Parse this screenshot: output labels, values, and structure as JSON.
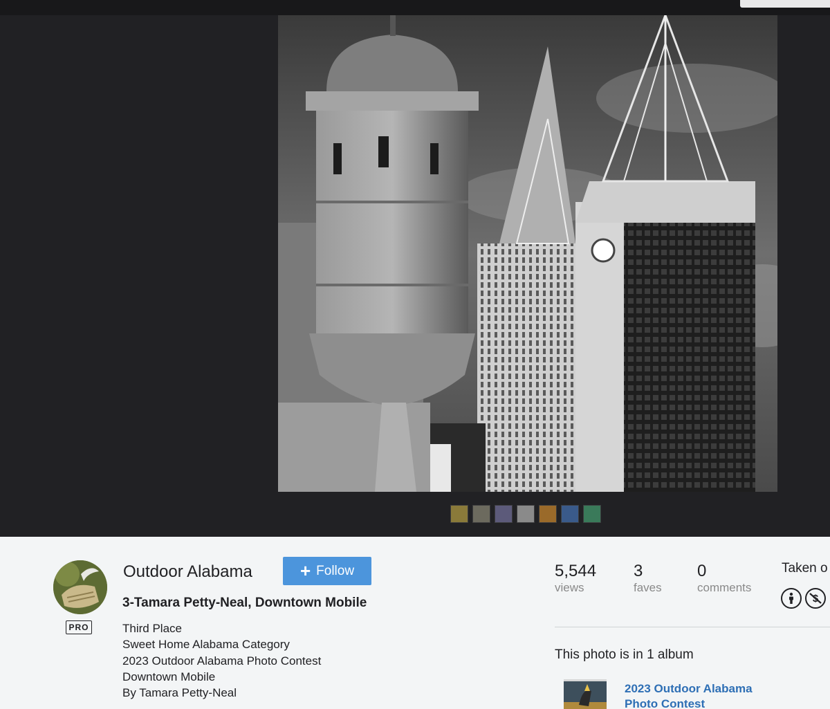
{
  "photo": {
    "title": "3-Tamara Petty-Neal, Downtown Mobile",
    "description": [
      "Third Place",
      "Sweet Home Alabama Category",
      "2023 Outdoor Alabama Photo Contest",
      "Downtown Mobile",
      "By Tamara Petty-Neal"
    ]
  },
  "owner": {
    "name": "Outdoor Alabama",
    "badge": "PRO",
    "follow_label": "Follow"
  },
  "stats": {
    "views": {
      "value": "5,544",
      "label": "views"
    },
    "faves": {
      "value": "3",
      "label": "faves"
    },
    "comments": {
      "value": "0",
      "label": "comments"
    }
  },
  "taken_label": "Taken o",
  "license_icons": [
    "attribution-icon",
    "noncommercial-icon"
  ],
  "albums": {
    "heading": "This photo is in 1 album",
    "items": [
      {
        "title": "2023 Outdoor Alabama Photo Contest"
      }
    ]
  },
  "filmstrip": {
    "thumbnails": [
      "#8a7a3a",
      "#6c6a5e",
      "#5c5a7a",
      "#8a8a8a",
      "#9a6a2a",
      "#3a5a8a",
      "#3a7a5a"
    ]
  },
  "colors": {
    "accent": "#4c95dc",
    "link": "#2e6fb5",
    "dark_bg": "#212124",
    "page_bg": "#f3f5f6"
  }
}
